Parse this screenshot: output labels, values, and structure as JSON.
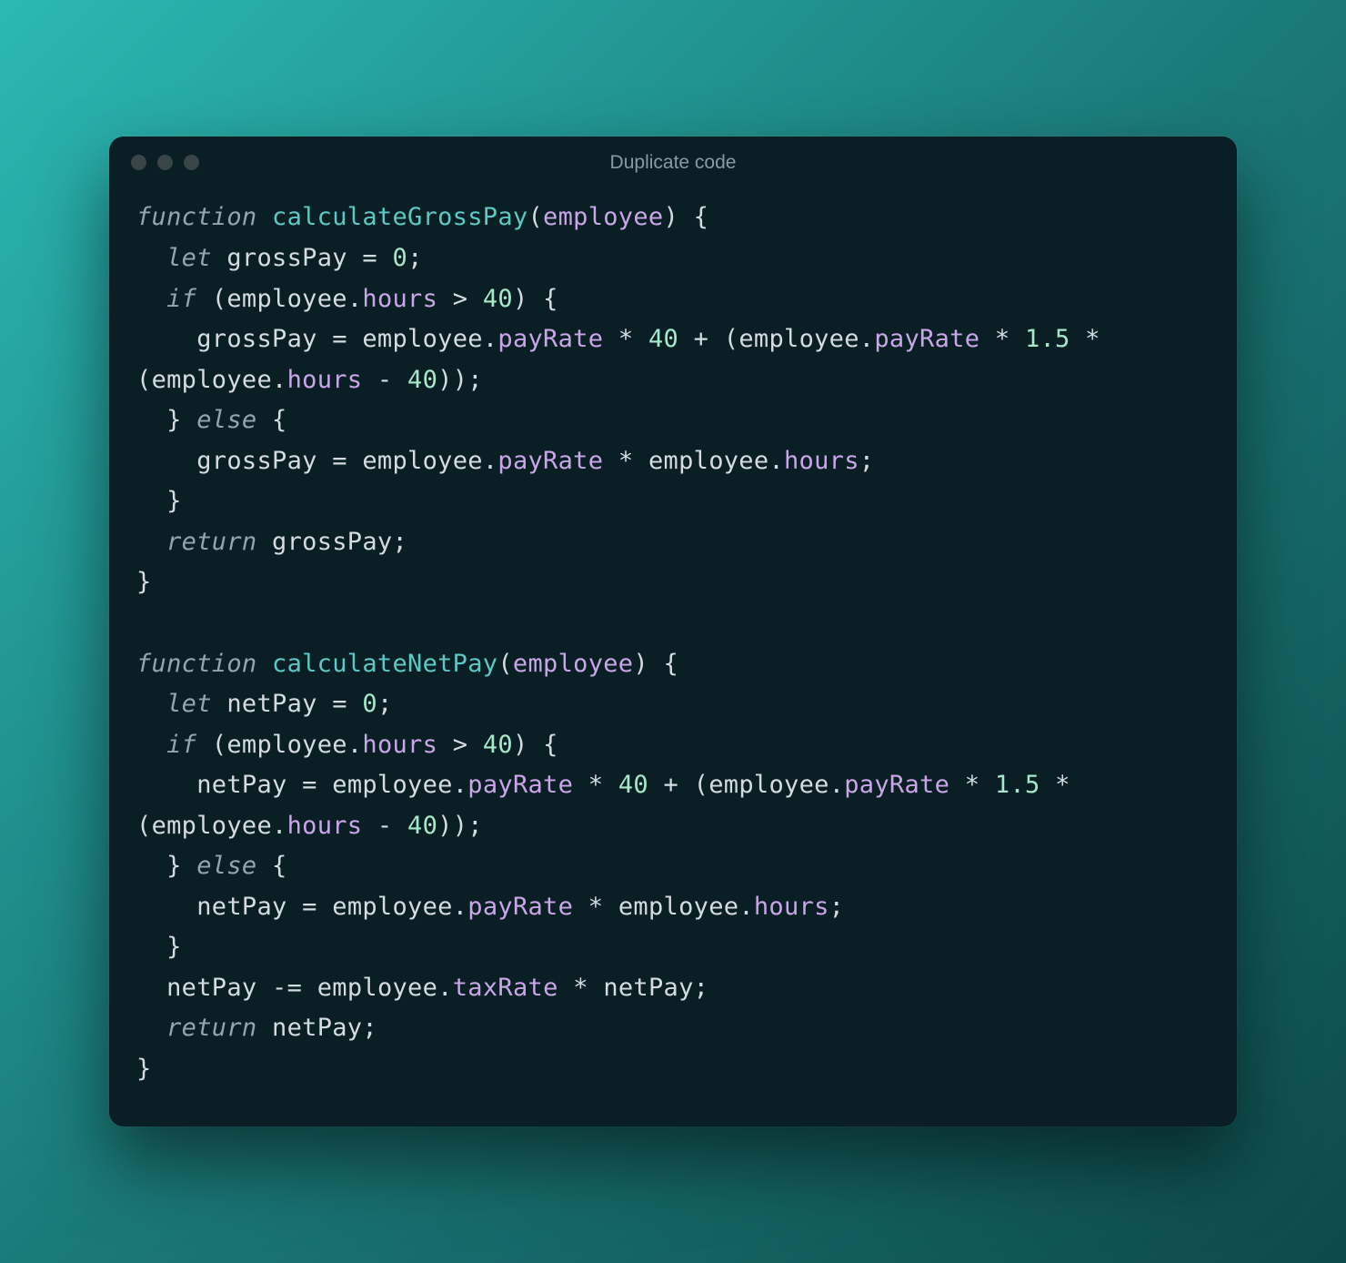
{
  "window": {
    "title": "Duplicate code"
  },
  "code": {
    "tokens": [
      {
        "t": "keyword",
        "v": "function"
      },
      {
        "t": "space",
        "v": " "
      },
      {
        "t": "funcname",
        "v": "calculateGrossPay"
      },
      {
        "t": "punct",
        "v": "("
      },
      {
        "t": "param",
        "v": "employee"
      },
      {
        "t": "punct",
        "v": ")"
      },
      {
        "t": "space",
        "v": " "
      },
      {
        "t": "punct",
        "v": "{"
      },
      {
        "t": "nl"
      },
      {
        "t": "indent",
        "v": "  "
      },
      {
        "t": "keyword",
        "v": "let"
      },
      {
        "t": "space",
        "v": " "
      },
      {
        "t": "ident",
        "v": "grossPay"
      },
      {
        "t": "space",
        "v": " "
      },
      {
        "t": "operator",
        "v": "="
      },
      {
        "t": "space",
        "v": " "
      },
      {
        "t": "number",
        "v": "0"
      },
      {
        "t": "punct",
        "v": ";"
      },
      {
        "t": "nl"
      },
      {
        "t": "indent",
        "v": "  "
      },
      {
        "t": "keyword",
        "v": "if"
      },
      {
        "t": "space",
        "v": " "
      },
      {
        "t": "punct",
        "v": "("
      },
      {
        "t": "ident",
        "v": "employee"
      },
      {
        "t": "punct",
        "v": "."
      },
      {
        "t": "prop",
        "v": "hours"
      },
      {
        "t": "space",
        "v": " "
      },
      {
        "t": "operator",
        "v": ">"
      },
      {
        "t": "space",
        "v": " "
      },
      {
        "t": "number",
        "v": "40"
      },
      {
        "t": "punct",
        "v": ")"
      },
      {
        "t": "space",
        "v": " "
      },
      {
        "t": "punct",
        "v": "{"
      },
      {
        "t": "nl"
      },
      {
        "t": "indent",
        "v": "    "
      },
      {
        "t": "ident",
        "v": "grossPay"
      },
      {
        "t": "space",
        "v": " "
      },
      {
        "t": "operator",
        "v": "="
      },
      {
        "t": "space",
        "v": " "
      },
      {
        "t": "ident",
        "v": "employee"
      },
      {
        "t": "punct",
        "v": "."
      },
      {
        "t": "prop",
        "v": "payRate"
      },
      {
        "t": "space",
        "v": " "
      },
      {
        "t": "operator",
        "v": "*"
      },
      {
        "t": "space",
        "v": " "
      },
      {
        "t": "number",
        "v": "40"
      },
      {
        "t": "space",
        "v": " "
      },
      {
        "t": "operator",
        "v": "+"
      },
      {
        "t": "space",
        "v": " "
      },
      {
        "t": "punct",
        "v": "("
      },
      {
        "t": "ident",
        "v": "employee"
      },
      {
        "t": "punct",
        "v": "."
      },
      {
        "t": "prop",
        "v": "payRate"
      },
      {
        "t": "space",
        "v": " "
      },
      {
        "t": "operator",
        "v": "*"
      },
      {
        "t": "space",
        "v": " "
      },
      {
        "t": "number",
        "v": "1.5"
      },
      {
        "t": "space",
        "v": " "
      },
      {
        "t": "operator",
        "v": "*"
      },
      {
        "t": "space",
        "v": " "
      },
      {
        "t": "punct",
        "v": "("
      },
      {
        "t": "ident",
        "v": "employee"
      },
      {
        "t": "punct",
        "v": "."
      },
      {
        "t": "prop",
        "v": "hours"
      },
      {
        "t": "space",
        "v": " "
      },
      {
        "t": "operator",
        "v": "-"
      },
      {
        "t": "space",
        "v": " "
      },
      {
        "t": "number",
        "v": "40"
      },
      {
        "t": "punct",
        "v": ")"
      },
      {
        "t": "punct",
        "v": ")"
      },
      {
        "t": "punct",
        "v": ";"
      },
      {
        "t": "nl"
      },
      {
        "t": "indent",
        "v": "  "
      },
      {
        "t": "punct",
        "v": "}"
      },
      {
        "t": "space",
        "v": " "
      },
      {
        "t": "keyword",
        "v": "else"
      },
      {
        "t": "space",
        "v": " "
      },
      {
        "t": "punct",
        "v": "{"
      },
      {
        "t": "nl"
      },
      {
        "t": "indent",
        "v": "    "
      },
      {
        "t": "ident",
        "v": "grossPay"
      },
      {
        "t": "space",
        "v": " "
      },
      {
        "t": "operator",
        "v": "="
      },
      {
        "t": "space",
        "v": " "
      },
      {
        "t": "ident",
        "v": "employee"
      },
      {
        "t": "punct",
        "v": "."
      },
      {
        "t": "prop",
        "v": "payRate"
      },
      {
        "t": "space",
        "v": " "
      },
      {
        "t": "operator",
        "v": "*"
      },
      {
        "t": "space",
        "v": " "
      },
      {
        "t": "ident",
        "v": "employee"
      },
      {
        "t": "punct",
        "v": "."
      },
      {
        "t": "prop",
        "v": "hours"
      },
      {
        "t": "punct",
        "v": ";"
      },
      {
        "t": "nl"
      },
      {
        "t": "indent",
        "v": "  "
      },
      {
        "t": "punct",
        "v": "}"
      },
      {
        "t": "nl"
      },
      {
        "t": "indent",
        "v": "  "
      },
      {
        "t": "keyword",
        "v": "return"
      },
      {
        "t": "space",
        "v": " "
      },
      {
        "t": "ident",
        "v": "grossPay"
      },
      {
        "t": "punct",
        "v": ";"
      },
      {
        "t": "nl"
      },
      {
        "t": "punct",
        "v": "}"
      },
      {
        "t": "nl"
      },
      {
        "t": "nl"
      },
      {
        "t": "keyword",
        "v": "function"
      },
      {
        "t": "space",
        "v": " "
      },
      {
        "t": "funcname",
        "v": "calculateNetPay"
      },
      {
        "t": "punct",
        "v": "("
      },
      {
        "t": "param",
        "v": "employee"
      },
      {
        "t": "punct",
        "v": ")"
      },
      {
        "t": "space",
        "v": " "
      },
      {
        "t": "punct",
        "v": "{"
      },
      {
        "t": "nl"
      },
      {
        "t": "indent",
        "v": "  "
      },
      {
        "t": "keyword",
        "v": "let"
      },
      {
        "t": "space",
        "v": " "
      },
      {
        "t": "ident",
        "v": "netPay"
      },
      {
        "t": "space",
        "v": " "
      },
      {
        "t": "operator",
        "v": "="
      },
      {
        "t": "space",
        "v": " "
      },
      {
        "t": "number",
        "v": "0"
      },
      {
        "t": "punct",
        "v": ";"
      },
      {
        "t": "nl"
      },
      {
        "t": "indent",
        "v": "  "
      },
      {
        "t": "keyword",
        "v": "if"
      },
      {
        "t": "space",
        "v": " "
      },
      {
        "t": "punct",
        "v": "("
      },
      {
        "t": "ident",
        "v": "employee"
      },
      {
        "t": "punct",
        "v": "."
      },
      {
        "t": "prop",
        "v": "hours"
      },
      {
        "t": "space",
        "v": " "
      },
      {
        "t": "operator",
        "v": ">"
      },
      {
        "t": "space",
        "v": " "
      },
      {
        "t": "number",
        "v": "40"
      },
      {
        "t": "punct",
        "v": ")"
      },
      {
        "t": "space",
        "v": " "
      },
      {
        "t": "punct",
        "v": "{"
      },
      {
        "t": "nl"
      },
      {
        "t": "indent",
        "v": "    "
      },
      {
        "t": "ident",
        "v": "netPay"
      },
      {
        "t": "space",
        "v": " "
      },
      {
        "t": "operator",
        "v": "="
      },
      {
        "t": "space",
        "v": " "
      },
      {
        "t": "ident",
        "v": "employee"
      },
      {
        "t": "punct",
        "v": "."
      },
      {
        "t": "prop",
        "v": "payRate"
      },
      {
        "t": "space",
        "v": " "
      },
      {
        "t": "operator",
        "v": "*"
      },
      {
        "t": "space",
        "v": " "
      },
      {
        "t": "number",
        "v": "40"
      },
      {
        "t": "space",
        "v": " "
      },
      {
        "t": "operator",
        "v": "+"
      },
      {
        "t": "space",
        "v": " "
      },
      {
        "t": "punct",
        "v": "("
      },
      {
        "t": "ident",
        "v": "employee"
      },
      {
        "t": "punct",
        "v": "."
      },
      {
        "t": "prop",
        "v": "payRate"
      },
      {
        "t": "space",
        "v": " "
      },
      {
        "t": "operator",
        "v": "*"
      },
      {
        "t": "space",
        "v": " "
      },
      {
        "t": "number",
        "v": "1.5"
      },
      {
        "t": "space",
        "v": " "
      },
      {
        "t": "operator",
        "v": "*"
      },
      {
        "t": "space",
        "v": " "
      },
      {
        "t": "punct",
        "v": "("
      },
      {
        "t": "ident",
        "v": "employee"
      },
      {
        "t": "punct",
        "v": "."
      },
      {
        "t": "prop",
        "v": "hours"
      },
      {
        "t": "space",
        "v": " "
      },
      {
        "t": "operator",
        "v": "-"
      },
      {
        "t": "space",
        "v": " "
      },
      {
        "t": "number",
        "v": "40"
      },
      {
        "t": "punct",
        "v": ")"
      },
      {
        "t": "punct",
        "v": ")"
      },
      {
        "t": "punct",
        "v": ";"
      },
      {
        "t": "nl"
      },
      {
        "t": "indent",
        "v": "  "
      },
      {
        "t": "punct",
        "v": "}"
      },
      {
        "t": "space",
        "v": " "
      },
      {
        "t": "keyword",
        "v": "else"
      },
      {
        "t": "space",
        "v": " "
      },
      {
        "t": "punct",
        "v": "{"
      },
      {
        "t": "nl"
      },
      {
        "t": "indent",
        "v": "    "
      },
      {
        "t": "ident",
        "v": "netPay"
      },
      {
        "t": "space",
        "v": " "
      },
      {
        "t": "operator",
        "v": "="
      },
      {
        "t": "space",
        "v": " "
      },
      {
        "t": "ident",
        "v": "employee"
      },
      {
        "t": "punct",
        "v": "."
      },
      {
        "t": "prop",
        "v": "payRate"
      },
      {
        "t": "space",
        "v": " "
      },
      {
        "t": "operator",
        "v": "*"
      },
      {
        "t": "space",
        "v": " "
      },
      {
        "t": "ident",
        "v": "employee"
      },
      {
        "t": "punct",
        "v": "."
      },
      {
        "t": "prop",
        "v": "hours"
      },
      {
        "t": "punct",
        "v": ";"
      },
      {
        "t": "nl"
      },
      {
        "t": "indent",
        "v": "  "
      },
      {
        "t": "punct",
        "v": "}"
      },
      {
        "t": "nl"
      },
      {
        "t": "indent",
        "v": "  "
      },
      {
        "t": "ident",
        "v": "netPay"
      },
      {
        "t": "space",
        "v": " "
      },
      {
        "t": "operator",
        "v": "-="
      },
      {
        "t": "space",
        "v": " "
      },
      {
        "t": "ident",
        "v": "employee"
      },
      {
        "t": "punct",
        "v": "."
      },
      {
        "t": "prop",
        "v": "taxRate"
      },
      {
        "t": "space",
        "v": " "
      },
      {
        "t": "operator",
        "v": "*"
      },
      {
        "t": "space",
        "v": " "
      },
      {
        "t": "ident",
        "v": "netPay"
      },
      {
        "t": "punct",
        "v": ";"
      },
      {
        "t": "nl"
      },
      {
        "t": "indent",
        "v": "  "
      },
      {
        "t": "keyword",
        "v": "return"
      },
      {
        "t": "space",
        "v": " "
      },
      {
        "t": "ident",
        "v": "netPay"
      },
      {
        "t": "punct",
        "v": ";"
      },
      {
        "t": "nl"
      },
      {
        "t": "punct",
        "v": "}"
      }
    ]
  }
}
